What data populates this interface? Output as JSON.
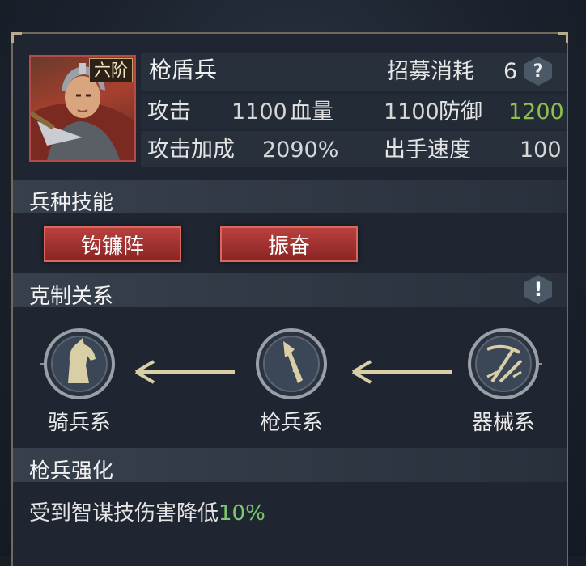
{
  "unit": {
    "tier": "六阶",
    "name": "枪盾兵",
    "recruit_label": "招募消耗",
    "recruit_cost": "6",
    "help_glyph": "?"
  },
  "stats": {
    "attack_label": "攻击",
    "attack_value": "1100",
    "hp_label": "血量",
    "hp_value": "1100",
    "defense_label": "防御",
    "defense_value": "1200",
    "attack_bonus_label": "攻击加成",
    "attack_bonus_value": "2090%",
    "speed_label": "出手速度",
    "speed_value": "100"
  },
  "skills": {
    "title": "兵种技能",
    "items": [
      "钩镰阵",
      "振奋"
    ]
  },
  "counter": {
    "title": "克制关系",
    "info_glyph": "!",
    "chain": [
      {
        "label": "骑兵系",
        "icon": "horse-icon"
      },
      {
        "label": "枪兵系",
        "icon": "spear-icon"
      },
      {
        "label": "器械系",
        "icon": "crossbow-icon"
      }
    ]
  },
  "enhance": {
    "title": "枪兵强化",
    "effect_prefix": "受到智谋技伤害降低",
    "effect_value": "10%"
  },
  "colors": {
    "accent_red": "#a83230",
    "value_green": "#8fbf4f",
    "emblem_gold": "#d9cfa6"
  }
}
